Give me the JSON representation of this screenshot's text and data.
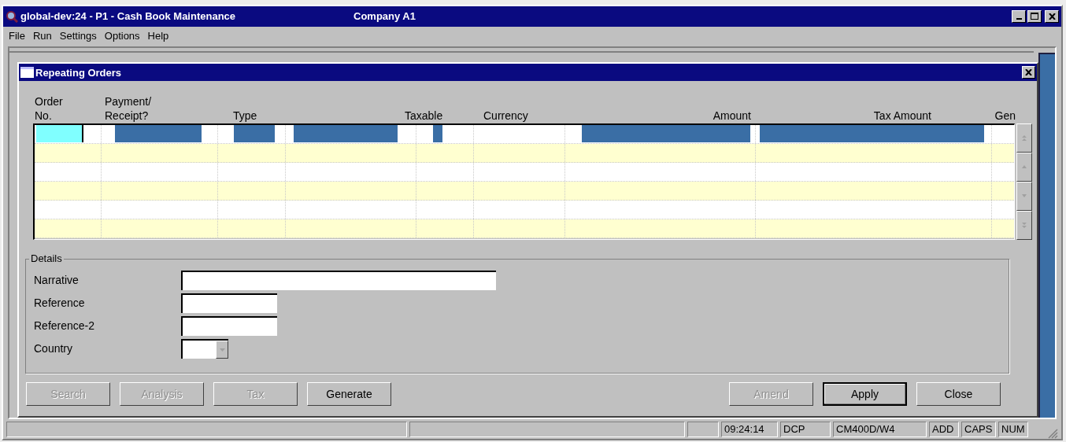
{
  "window": {
    "title": "global-dev:24 - P1 - Cash Book Maintenance",
    "company": "Company A1"
  },
  "menu": [
    "File",
    "Run",
    "Settings",
    "Options",
    "Help"
  ],
  "dialog": {
    "title": "Repeating Orders"
  },
  "table": {
    "columns": [
      {
        "label": "Order\nNo."
      },
      {
        "label": "Payment/\nReceipt?"
      },
      {
        "label": "Type"
      },
      {
        "label": "Taxable"
      },
      {
        "label": "Currency"
      },
      {
        "label": "Amount"
      },
      {
        "label": "Tax Amount"
      },
      {
        "label": "Gen"
      }
    ],
    "rows": [
      {
        "selected": true
      },
      {
        "selected": false
      },
      {
        "selected": false
      },
      {
        "selected": false
      },
      {
        "selected": false
      },
      {
        "selected": false
      }
    ]
  },
  "details": {
    "title": "Details",
    "fields": [
      {
        "label": "Narrative",
        "kind": "text"
      },
      {
        "label": "Reference",
        "kind": "text"
      },
      {
        "label": "Reference-2",
        "kind": "text"
      },
      {
        "label": "Country",
        "kind": "dropdown"
      }
    ]
  },
  "left_buttons": [
    {
      "label": "Search",
      "disabled": true
    },
    {
      "label": "Analysis",
      "disabled": true
    },
    {
      "label": "Tax",
      "disabled": true
    },
    {
      "label": "Generate",
      "disabled": false
    }
  ],
  "right_buttons": [
    {
      "label": "Amend",
      "disabled": true,
      "default": false
    },
    {
      "label": "Apply",
      "disabled": false,
      "default": true
    },
    {
      "label": "Close",
      "disabled": false,
      "default": false
    }
  ],
  "status_bar": [
    "09:24:14",
    "DCP",
    "CM400D/W4",
    "ADD",
    "CAPS",
    "NUM"
  ]
}
